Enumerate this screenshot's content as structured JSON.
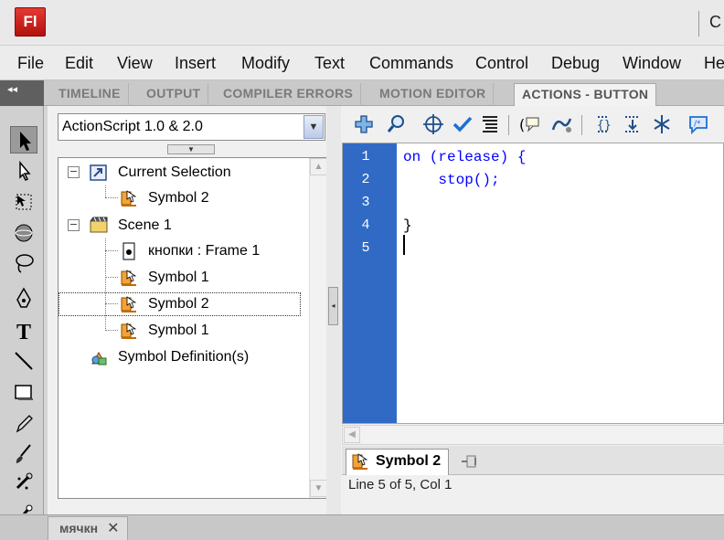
{
  "app": {
    "logo": "Fl",
    "title_partial": "C"
  },
  "menu": [
    "File",
    "Edit",
    "View",
    "Insert",
    "Modify",
    "Text",
    "Commands",
    "Control",
    "Debug",
    "Window",
    "He"
  ],
  "panel_tabs": [
    "TIMELINE",
    "OUTPUT",
    "COMPILER ERRORS",
    "MOTION EDITOR",
    "ACTIONS - BUTTON"
  ],
  "active_panel_tab": "ACTIONS - BUTTON",
  "collapse_glyph": "◂◂",
  "actions": {
    "language": "ActionScript 1.0 & 2.0",
    "tree": {
      "current_selection": "Current Selection",
      "current_selection_children": [
        "Symbol 2"
      ],
      "scene": "Scene 1",
      "scene_children": [
        "кнопки : Frame 1",
        "Symbol 1",
        "Symbol 2",
        "Symbol 1"
      ],
      "symbol_definitions": "Symbol Definition(s)"
    },
    "code_lines": [
      {
        "num": "1",
        "text": "on (release) {"
      },
      {
        "num": "2",
        "text": "    stop();"
      },
      {
        "num": "3",
        "text": ""
      },
      {
        "num": "4",
        "text": "}"
      },
      {
        "num": "5",
        "text": ""
      }
    ],
    "script_tab": "Symbol 2",
    "status": "Line 5 of 5, Col 1"
  },
  "document_tab": "мячкн",
  "doc_close": "✕",
  "colors": {
    "gutter": "#316ac5",
    "keyword": "#0000ff",
    "logo_red": "#c8201b"
  }
}
